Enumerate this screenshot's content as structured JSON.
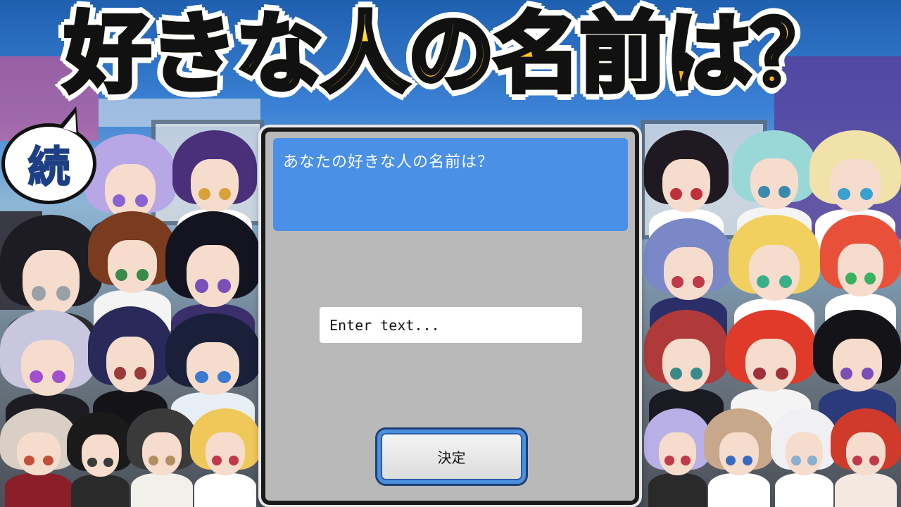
{
  "title": {
    "text": "好きな人の名前は？"
  },
  "badge": {
    "text": "続"
  },
  "dialog": {
    "prompt": "あなたの好きな人の名前は？",
    "input": {
      "value": "",
      "placeholder": "Enter text..."
    },
    "confirm_label": "決定"
  },
  "colors": {
    "dialog_bg": "#b9b9b9",
    "header_bg": "#4a90e6",
    "button_border": "#4a8fe0",
    "title_fill": "#ffd21a",
    "badge_text": "#1e3f86"
  }
}
